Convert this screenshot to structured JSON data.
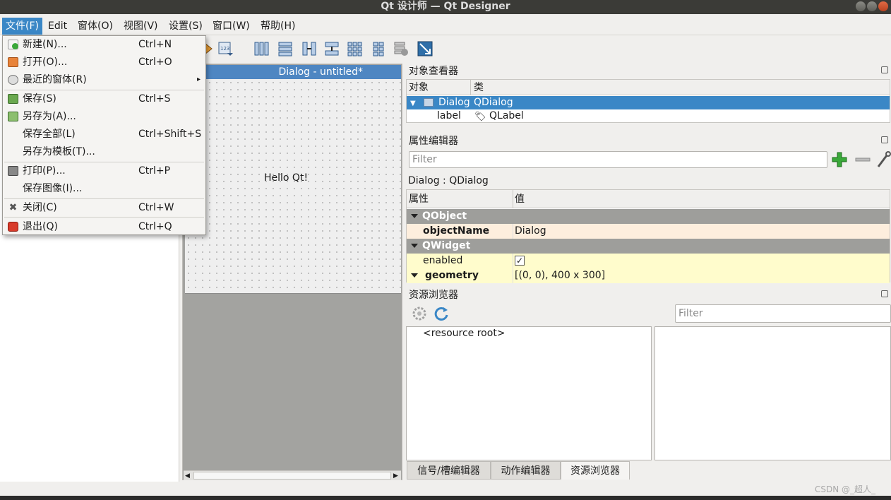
{
  "window": {
    "title": "Qt 设计师 — Qt Designer"
  },
  "menubar": {
    "items": [
      "文件(F)",
      "Edit",
      "窗体(O)",
      "视图(V)",
      "设置(S)",
      "窗口(W)",
      "帮助(H)"
    ]
  },
  "file_menu": {
    "items": [
      {
        "label": "新建(N)...",
        "shortcut": "Ctrl+N",
        "icon": "new-file-icon"
      },
      {
        "label": "打开(O)...",
        "shortcut": "Ctrl+O",
        "icon": "open-folder-icon"
      },
      {
        "label": "最近的窗体(R)",
        "shortcut": "",
        "icon": "recent-icon",
        "submenu": "▸"
      },
      {
        "label": "保存(S)",
        "shortcut": "Ctrl+S",
        "icon": "save-icon"
      },
      {
        "label": "另存为(A)...",
        "shortcut": "",
        "icon": "save-as-icon"
      },
      {
        "label": "保存全部(L)",
        "shortcut": "Ctrl+Shift+S",
        "icon": ""
      },
      {
        "label": "另存为模板(T)...",
        "shortcut": "",
        "icon": ""
      },
      {
        "label": "打印(P)...",
        "shortcut": "Ctrl+P",
        "icon": "printer-icon"
      },
      {
        "label": "保存图像(I)...",
        "shortcut": "",
        "icon": ""
      },
      {
        "label": "关闭(C)",
        "shortcut": "Ctrl+W",
        "icon": "close-icon"
      },
      {
        "label": "退出(Q)",
        "shortcut": "Ctrl+Q",
        "icon": "exit-icon"
      }
    ]
  },
  "form": {
    "window_title": "Dialog - untitled*",
    "label_text": "Hello Qt!"
  },
  "object_inspector": {
    "title": "对象查看器",
    "col_object": "对象",
    "col_class": "类",
    "rows": [
      {
        "object": "Dialog",
        "class": "QDialog"
      },
      {
        "object": "label",
        "class": "QLabel"
      }
    ]
  },
  "property_editor": {
    "title": "属性编辑器",
    "filter_placeholder": "Filter",
    "context": "Dialog : QDialog",
    "col_property": "属性",
    "col_value": "值",
    "groups": [
      {
        "name": "QObject"
      },
      {
        "name": "QWidget"
      }
    ],
    "props": [
      {
        "name": "objectName",
        "value": "Dialog"
      },
      {
        "name": "enabled",
        "value": "✓"
      },
      {
        "name": "geometry",
        "value": "[(0, 0), 400 x 300]"
      }
    ]
  },
  "resource_browser": {
    "title": "资源浏览器",
    "filter_placeholder": "Filter",
    "root": "<resource root>"
  },
  "bottom_tabs": [
    "信号/槽编辑器",
    "动作编辑器",
    "资源浏览器"
  ],
  "watermark": "CSDN @_超人_",
  "colors": {
    "accent": "#3a87c6",
    "group_bg": "#9e9e9b",
    "objectname_bg": "#fdeedd",
    "highlight_row": "#fffccc"
  }
}
